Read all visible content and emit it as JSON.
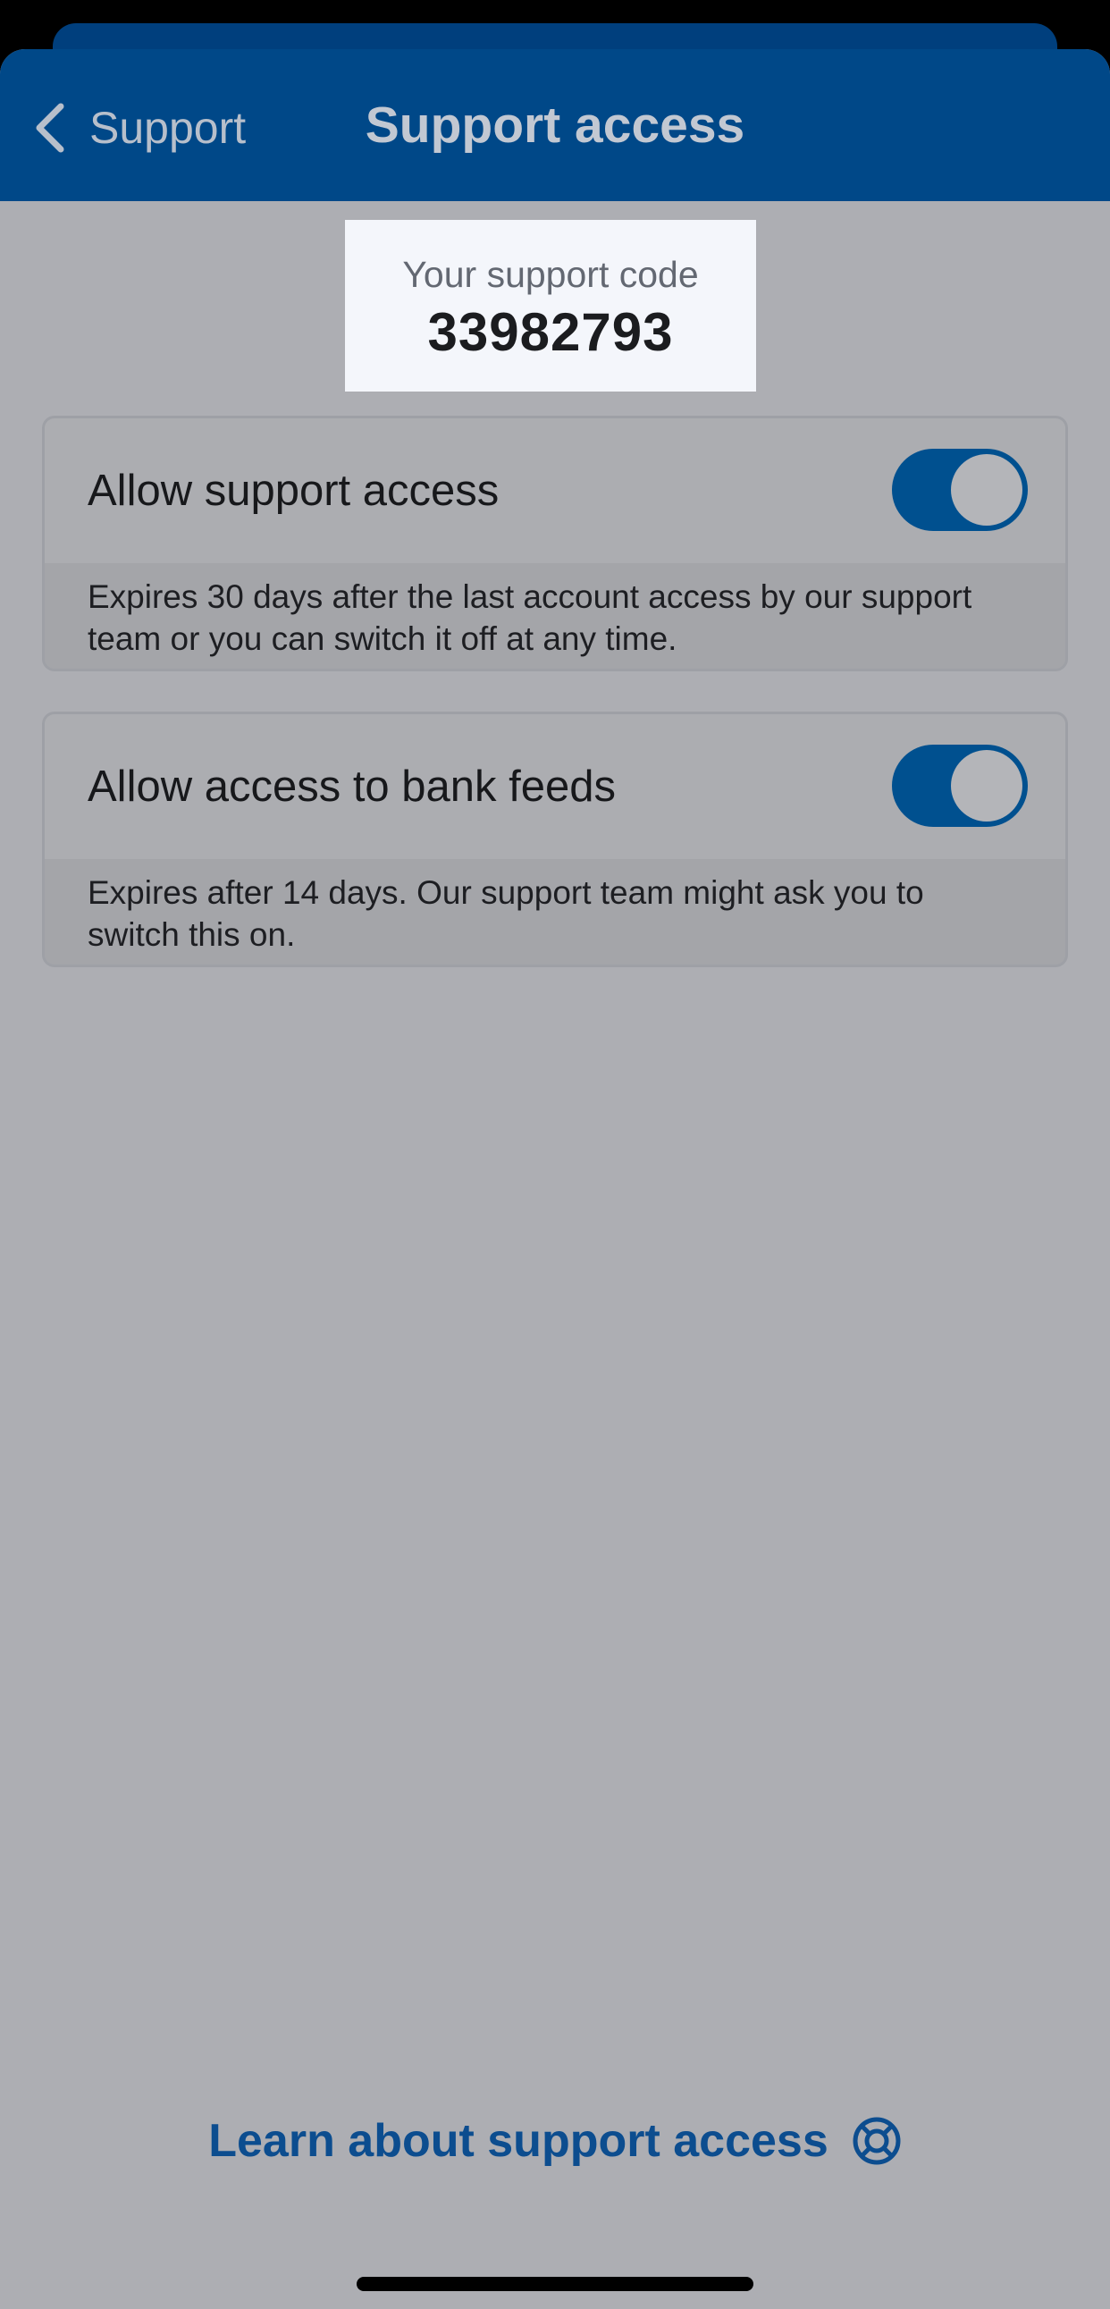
{
  "nav": {
    "back_label": "Support",
    "title": "Support access"
  },
  "support_code": {
    "label": "Your support code",
    "value": "33982793"
  },
  "settings": [
    {
      "title": "Allow support access",
      "enabled": true,
      "description": "Expires 30 days after the last account access by our support team or you can switch it off at any time."
    },
    {
      "title": "Allow access to bank feeds",
      "enabled": true,
      "description": "Expires after 14 days. Our support team might ask you to switch this on."
    }
  ],
  "footer": {
    "learn_link": "Learn about support access",
    "learn_icon": "lifebuoy-icon"
  },
  "colors": {
    "brand_blue": "#004888",
    "toggle_on": "#00508f",
    "link": "#0c4d8f",
    "dim_background": "#adaeb3"
  }
}
